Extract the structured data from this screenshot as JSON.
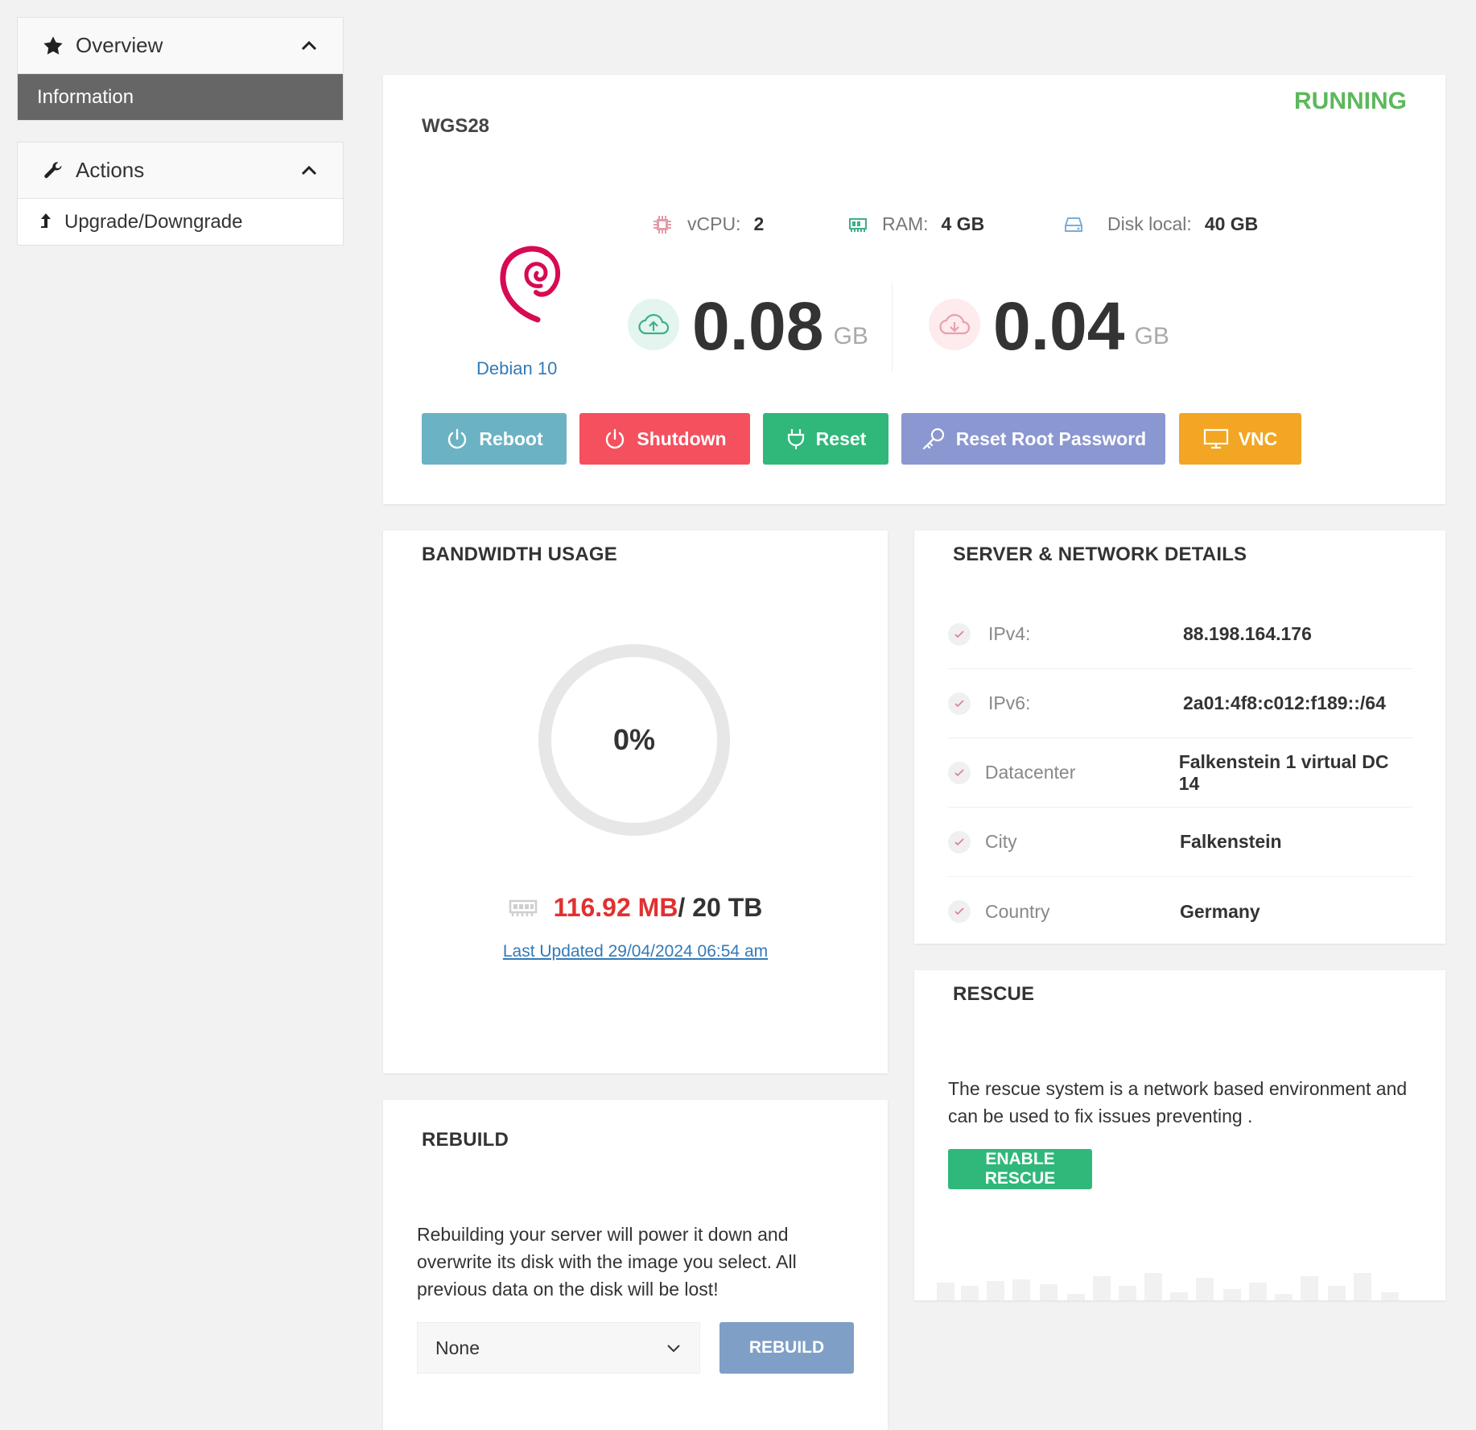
{
  "sidebar": {
    "overview": {
      "label": "Overview",
      "items": [
        {
          "label": "Information",
          "active": true
        }
      ]
    },
    "actions": {
      "label": "Actions",
      "items": [
        {
          "label": "Upgrade/Downgrade"
        }
      ]
    }
  },
  "server": {
    "status": "RUNNING",
    "name": "WGS28",
    "os": "Debian 10",
    "specs": [
      {
        "key": "vCPU:",
        "value": "2",
        "icon": "cpu-icon"
      },
      {
        "key": "RAM:",
        "value": "4 GB",
        "icon": "ram-icon"
      },
      {
        "key": "Disk local:",
        "value": "40 GB",
        "icon": "disk-icon"
      }
    ],
    "upload": {
      "value": "0.08",
      "unit": "GB"
    },
    "download": {
      "value": "0.04",
      "unit": "GB"
    },
    "buttons": {
      "reboot": "Reboot",
      "shutdown": "Shutdown",
      "reset": "Reset",
      "reset_password": "Reset Root Password",
      "vnc": "VNC"
    }
  },
  "bandwidth": {
    "title": "BANDWIDTH USAGE",
    "percent": "0%",
    "percent_value": 0,
    "used": "116.92 MB",
    "total": "/ 20 TB",
    "last_updated": "Last Updated 29/04/2024 06:54 am"
  },
  "details": {
    "title": "SERVER & NETWORK DETAILS",
    "rows": [
      {
        "key": "IPv4:",
        "value": "88.198.164.176"
      },
      {
        "key": "IPv6:",
        "value": "2a01:4f8:c012:f189::/64"
      },
      {
        "key": "Datacenter",
        "value": "Falkenstein 1 virtual DC 14"
      },
      {
        "key": "City",
        "value": "Falkenstein"
      },
      {
        "key": "Country",
        "value": "Germany"
      }
    ]
  },
  "rescue": {
    "title": "RESCUE",
    "text": "The rescue system is a network based environment and can be used to fix issues preventing .",
    "button": "ENABLE RESCUE"
  },
  "rebuild": {
    "title": "REBUILD",
    "text": "Rebuilding your server will power it down and overwrite its disk with the image you select. All previous data on the disk will be lost!",
    "selected": "None",
    "button": "REBUILD"
  },
  "colors": {
    "running": "#5cb85c",
    "reboot": "#6bb3c4",
    "shutdown": "#f5505e",
    "reset": "#2fb87a",
    "reset_password": "#8b97d1",
    "vnc": "#f2a623",
    "used": "#e03131",
    "link": "#337ab7"
  }
}
